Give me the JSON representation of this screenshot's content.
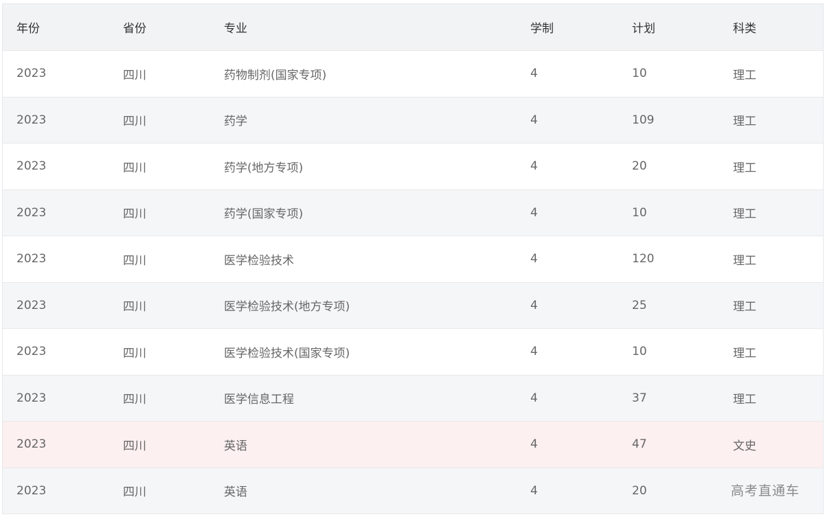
{
  "table": {
    "columns": {
      "year": "年份",
      "province": "省份",
      "major": "专业",
      "length": "学制",
      "plan": "计划",
      "category": "科类"
    },
    "rows": [
      {
        "year": "2023",
        "province": "四川",
        "major": "药物制剂(国家专项)",
        "length": "4",
        "plan": "10",
        "category": "理工"
      },
      {
        "year": "2023",
        "province": "四川",
        "major": "药学",
        "length": "4",
        "plan": "109",
        "category": "理工"
      },
      {
        "year": "2023",
        "province": "四川",
        "major": "药学(地方专项)",
        "length": "4",
        "plan": "20",
        "category": "理工"
      },
      {
        "year": "2023",
        "province": "四川",
        "major": "药学(国家专项)",
        "length": "4",
        "plan": "10",
        "category": "理工"
      },
      {
        "year": "2023",
        "province": "四川",
        "major": "医学检验技术",
        "length": "4",
        "plan": "120",
        "category": "理工"
      },
      {
        "year": "2023",
        "province": "四川",
        "major": "医学检验技术(地方专项)",
        "length": "4",
        "plan": "25",
        "category": "理工"
      },
      {
        "year": "2023",
        "province": "四川",
        "major": "医学检验技术(国家专项)",
        "length": "4",
        "plan": "10",
        "category": "理工"
      },
      {
        "year": "2023",
        "province": "四川",
        "major": "医学信息工程",
        "length": "4",
        "plan": "37",
        "category": "理工"
      },
      {
        "year": "2023",
        "province": "四川",
        "major": "英语",
        "length": "4",
        "plan": "47",
        "category": "文史"
      },
      {
        "year": "2023",
        "province": "四川",
        "major": "英语",
        "length": "4",
        "plan": "20",
        "category": ""
      }
    ]
  },
  "watermark": "高考直通车"
}
